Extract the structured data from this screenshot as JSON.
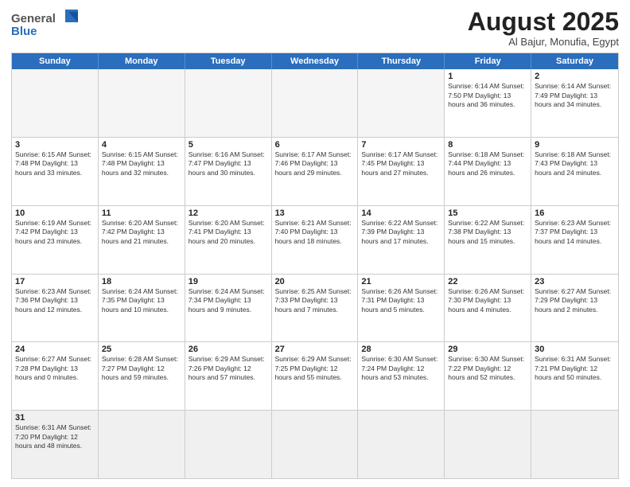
{
  "header": {
    "logo_general": "General",
    "logo_blue": "Blue",
    "title": "August 2025",
    "subtitle": "Al Bajur, Monufia, Egypt"
  },
  "weekdays": [
    "Sunday",
    "Monday",
    "Tuesday",
    "Wednesday",
    "Thursday",
    "Friday",
    "Saturday"
  ],
  "weeks": [
    [
      {
        "day": "",
        "info": "",
        "empty": true
      },
      {
        "day": "",
        "info": "",
        "empty": true
      },
      {
        "day": "",
        "info": "",
        "empty": true
      },
      {
        "day": "",
        "info": "",
        "empty": true
      },
      {
        "day": "",
        "info": "",
        "empty": true
      },
      {
        "day": "1",
        "info": "Sunrise: 6:14 AM\nSunset: 7:50 PM\nDaylight: 13 hours and 36 minutes."
      },
      {
        "day": "2",
        "info": "Sunrise: 6:14 AM\nSunset: 7:49 PM\nDaylight: 13 hours and 34 minutes."
      }
    ],
    [
      {
        "day": "3",
        "info": "Sunrise: 6:15 AM\nSunset: 7:48 PM\nDaylight: 13 hours and 33 minutes."
      },
      {
        "day": "4",
        "info": "Sunrise: 6:15 AM\nSunset: 7:48 PM\nDaylight: 13 hours and 32 minutes."
      },
      {
        "day": "5",
        "info": "Sunrise: 6:16 AM\nSunset: 7:47 PM\nDaylight: 13 hours and 30 minutes."
      },
      {
        "day": "6",
        "info": "Sunrise: 6:17 AM\nSunset: 7:46 PM\nDaylight: 13 hours and 29 minutes."
      },
      {
        "day": "7",
        "info": "Sunrise: 6:17 AM\nSunset: 7:45 PM\nDaylight: 13 hours and 27 minutes."
      },
      {
        "day": "8",
        "info": "Sunrise: 6:18 AM\nSunset: 7:44 PM\nDaylight: 13 hours and 26 minutes."
      },
      {
        "day": "9",
        "info": "Sunrise: 6:18 AM\nSunset: 7:43 PM\nDaylight: 13 hours and 24 minutes."
      }
    ],
    [
      {
        "day": "10",
        "info": "Sunrise: 6:19 AM\nSunset: 7:42 PM\nDaylight: 13 hours and 23 minutes."
      },
      {
        "day": "11",
        "info": "Sunrise: 6:20 AM\nSunset: 7:42 PM\nDaylight: 13 hours and 21 minutes."
      },
      {
        "day": "12",
        "info": "Sunrise: 6:20 AM\nSunset: 7:41 PM\nDaylight: 13 hours and 20 minutes."
      },
      {
        "day": "13",
        "info": "Sunrise: 6:21 AM\nSunset: 7:40 PM\nDaylight: 13 hours and 18 minutes."
      },
      {
        "day": "14",
        "info": "Sunrise: 6:22 AM\nSunset: 7:39 PM\nDaylight: 13 hours and 17 minutes."
      },
      {
        "day": "15",
        "info": "Sunrise: 6:22 AM\nSunset: 7:38 PM\nDaylight: 13 hours and 15 minutes."
      },
      {
        "day": "16",
        "info": "Sunrise: 6:23 AM\nSunset: 7:37 PM\nDaylight: 13 hours and 14 minutes."
      }
    ],
    [
      {
        "day": "17",
        "info": "Sunrise: 6:23 AM\nSunset: 7:36 PM\nDaylight: 13 hours and 12 minutes."
      },
      {
        "day": "18",
        "info": "Sunrise: 6:24 AM\nSunset: 7:35 PM\nDaylight: 13 hours and 10 minutes."
      },
      {
        "day": "19",
        "info": "Sunrise: 6:24 AM\nSunset: 7:34 PM\nDaylight: 13 hours and 9 minutes."
      },
      {
        "day": "20",
        "info": "Sunrise: 6:25 AM\nSunset: 7:33 PM\nDaylight: 13 hours and 7 minutes."
      },
      {
        "day": "21",
        "info": "Sunrise: 6:26 AM\nSunset: 7:31 PM\nDaylight: 13 hours and 5 minutes."
      },
      {
        "day": "22",
        "info": "Sunrise: 6:26 AM\nSunset: 7:30 PM\nDaylight: 13 hours and 4 minutes."
      },
      {
        "day": "23",
        "info": "Sunrise: 6:27 AM\nSunset: 7:29 PM\nDaylight: 13 hours and 2 minutes."
      }
    ],
    [
      {
        "day": "24",
        "info": "Sunrise: 6:27 AM\nSunset: 7:28 PM\nDaylight: 13 hours and 0 minutes."
      },
      {
        "day": "25",
        "info": "Sunrise: 6:28 AM\nSunset: 7:27 PM\nDaylight: 12 hours and 59 minutes."
      },
      {
        "day": "26",
        "info": "Sunrise: 6:29 AM\nSunset: 7:26 PM\nDaylight: 12 hours and 57 minutes."
      },
      {
        "day": "27",
        "info": "Sunrise: 6:29 AM\nSunset: 7:25 PM\nDaylight: 12 hours and 55 minutes."
      },
      {
        "day": "28",
        "info": "Sunrise: 6:30 AM\nSunset: 7:24 PM\nDaylight: 12 hours and 53 minutes."
      },
      {
        "day": "29",
        "info": "Sunrise: 6:30 AM\nSunset: 7:22 PM\nDaylight: 12 hours and 52 minutes."
      },
      {
        "day": "30",
        "info": "Sunrise: 6:31 AM\nSunset: 7:21 PM\nDaylight: 12 hours and 50 minutes."
      }
    ],
    [
      {
        "day": "31",
        "info": "Sunrise: 6:31 AM\nSunset: 7:20 PM\nDaylight: 12 hours and 48 minutes."
      },
      {
        "day": "",
        "info": "",
        "empty": true
      },
      {
        "day": "",
        "info": "",
        "empty": true
      },
      {
        "day": "",
        "info": "",
        "empty": true
      },
      {
        "day": "",
        "info": "",
        "empty": true
      },
      {
        "day": "",
        "info": "",
        "empty": true
      },
      {
        "day": "",
        "info": "",
        "empty": true
      }
    ]
  ]
}
